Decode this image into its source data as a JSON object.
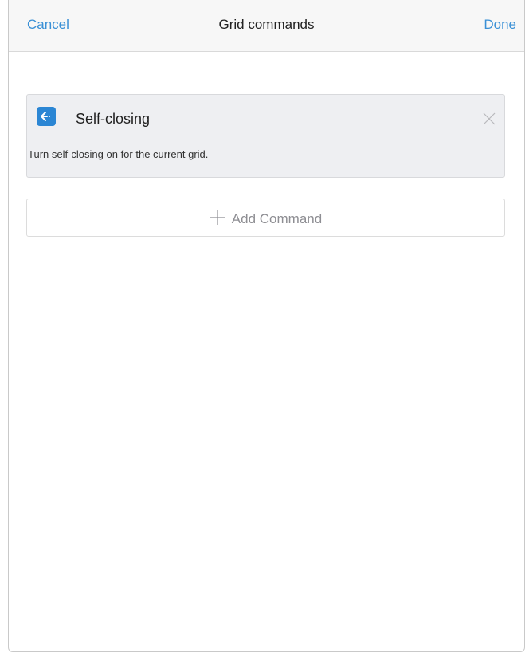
{
  "navbar": {
    "cancel_label": "Cancel",
    "title": "Grid commands",
    "done_label": "Done"
  },
  "command": {
    "icon": "arrow-left-icon",
    "title": "Self-closing",
    "description": "Turn self-closing on for the current grid."
  },
  "add_command": {
    "icon": "plus-icon",
    "label": "Add Command"
  },
  "colors": {
    "accent": "#3a90d6",
    "icon_bg": "#2b86d4",
    "card_bg": "#eeeff2"
  }
}
